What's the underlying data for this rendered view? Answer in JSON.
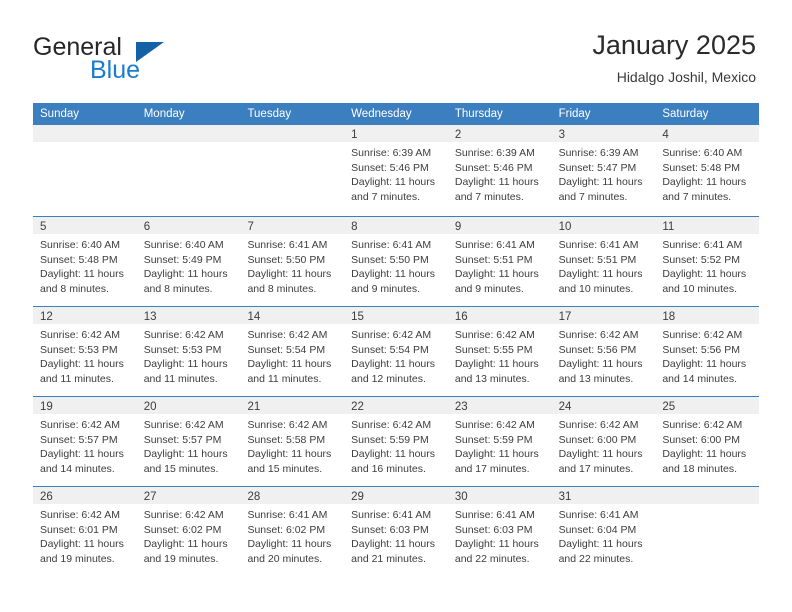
{
  "brand": {
    "name_line1": "General",
    "name_line2": "Blue",
    "accent_color": "#1b7ccd",
    "triangle_color": "#1362a8"
  },
  "header": {
    "title": "January 2025",
    "subtitle": "Hidalgo Joshil, Mexico"
  },
  "theme": {
    "weekday_bar_color": "#3c7fc1",
    "daynum_strip_color": "#f0f0f0",
    "text_color": "#3d3d3d"
  },
  "weekdays": [
    "Sunday",
    "Monday",
    "Tuesday",
    "Wednesday",
    "Thursday",
    "Friday",
    "Saturday"
  ],
  "labels": {
    "sunrise_prefix": "Sunrise:",
    "sunset_prefix": "Sunset:",
    "daylight_prefix": "Daylight:"
  },
  "weeks": [
    [
      {
        "day": "",
        "empty": true,
        "line1": "",
        "line2": "",
        "line3": "",
        "line4": ""
      },
      {
        "day": "",
        "empty": true,
        "line1": "",
        "line2": "",
        "line3": "",
        "line4": ""
      },
      {
        "day": "",
        "empty": true,
        "line1": "",
        "line2": "",
        "line3": "",
        "line4": ""
      },
      {
        "day": "1",
        "empty": false,
        "line1": "Sunrise: 6:39 AM",
        "line2": "Sunset: 5:46 PM",
        "line3": "Daylight: 11 hours",
        "line4": "and 7 minutes."
      },
      {
        "day": "2",
        "empty": false,
        "line1": "Sunrise: 6:39 AM",
        "line2": "Sunset: 5:46 PM",
        "line3": "Daylight: 11 hours",
        "line4": "and 7 minutes."
      },
      {
        "day": "3",
        "empty": false,
        "line1": "Sunrise: 6:39 AM",
        "line2": "Sunset: 5:47 PM",
        "line3": "Daylight: 11 hours",
        "line4": "and 7 minutes."
      },
      {
        "day": "4",
        "empty": false,
        "line1": "Sunrise: 6:40 AM",
        "line2": "Sunset: 5:48 PM",
        "line3": "Daylight: 11 hours",
        "line4": "and 7 minutes."
      }
    ],
    [
      {
        "day": "5",
        "empty": false,
        "line1": "Sunrise: 6:40 AM",
        "line2": "Sunset: 5:48 PM",
        "line3": "Daylight: 11 hours",
        "line4": "and 8 minutes."
      },
      {
        "day": "6",
        "empty": false,
        "line1": "Sunrise: 6:40 AM",
        "line2": "Sunset: 5:49 PM",
        "line3": "Daylight: 11 hours",
        "line4": "and 8 minutes."
      },
      {
        "day": "7",
        "empty": false,
        "line1": "Sunrise: 6:41 AM",
        "line2": "Sunset: 5:50 PM",
        "line3": "Daylight: 11 hours",
        "line4": "and 8 minutes."
      },
      {
        "day": "8",
        "empty": false,
        "line1": "Sunrise: 6:41 AM",
        "line2": "Sunset: 5:50 PM",
        "line3": "Daylight: 11 hours",
        "line4": "and 9 minutes."
      },
      {
        "day": "9",
        "empty": false,
        "line1": "Sunrise: 6:41 AM",
        "line2": "Sunset: 5:51 PM",
        "line3": "Daylight: 11 hours",
        "line4": "and 9 minutes."
      },
      {
        "day": "10",
        "empty": false,
        "line1": "Sunrise: 6:41 AM",
        "line2": "Sunset: 5:51 PM",
        "line3": "Daylight: 11 hours",
        "line4": "and 10 minutes."
      },
      {
        "day": "11",
        "empty": false,
        "line1": "Sunrise: 6:41 AM",
        "line2": "Sunset: 5:52 PM",
        "line3": "Daylight: 11 hours",
        "line4": "and 10 minutes."
      }
    ],
    [
      {
        "day": "12",
        "empty": false,
        "line1": "Sunrise: 6:42 AM",
        "line2": "Sunset: 5:53 PM",
        "line3": "Daylight: 11 hours",
        "line4": "and 11 minutes."
      },
      {
        "day": "13",
        "empty": false,
        "line1": "Sunrise: 6:42 AM",
        "line2": "Sunset: 5:53 PM",
        "line3": "Daylight: 11 hours",
        "line4": "and 11 minutes."
      },
      {
        "day": "14",
        "empty": false,
        "line1": "Sunrise: 6:42 AM",
        "line2": "Sunset: 5:54 PM",
        "line3": "Daylight: 11 hours",
        "line4": "and 11 minutes."
      },
      {
        "day": "15",
        "empty": false,
        "line1": "Sunrise: 6:42 AM",
        "line2": "Sunset: 5:54 PM",
        "line3": "Daylight: 11 hours",
        "line4": "and 12 minutes."
      },
      {
        "day": "16",
        "empty": false,
        "line1": "Sunrise: 6:42 AM",
        "line2": "Sunset: 5:55 PM",
        "line3": "Daylight: 11 hours",
        "line4": "and 13 minutes."
      },
      {
        "day": "17",
        "empty": false,
        "line1": "Sunrise: 6:42 AM",
        "line2": "Sunset: 5:56 PM",
        "line3": "Daylight: 11 hours",
        "line4": "and 13 minutes."
      },
      {
        "day": "18",
        "empty": false,
        "line1": "Sunrise: 6:42 AM",
        "line2": "Sunset: 5:56 PM",
        "line3": "Daylight: 11 hours",
        "line4": "and 14 minutes."
      }
    ],
    [
      {
        "day": "19",
        "empty": false,
        "line1": "Sunrise: 6:42 AM",
        "line2": "Sunset: 5:57 PM",
        "line3": "Daylight: 11 hours",
        "line4": "and 14 minutes."
      },
      {
        "day": "20",
        "empty": false,
        "line1": "Sunrise: 6:42 AM",
        "line2": "Sunset: 5:57 PM",
        "line3": "Daylight: 11 hours",
        "line4": "and 15 minutes."
      },
      {
        "day": "21",
        "empty": false,
        "line1": "Sunrise: 6:42 AM",
        "line2": "Sunset: 5:58 PM",
        "line3": "Daylight: 11 hours",
        "line4": "and 15 minutes."
      },
      {
        "day": "22",
        "empty": false,
        "line1": "Sunrise: 6:42 AM",
        "line2": "Sunset: 5:59 PM",
        "line3": "Daylight: 11 hours",
        "line4": "and 16 minutes."
      },
      {
        "day": "23",
        "empty": false,
        "line1": "Sunrise: 6:42 AM",
        "line2": "Sunset: 5:59 PM",
        "line3": "Daylight: 11 hours",
        "line4": "and 17 minutes."
      },
      {
        "day": "24",
        "empty": false,
        "line1": "Sunrise: 6:42 AM",
        "line2": "Sunset: 6:00 PM",
        "line3": "Daylight: 11 hours",
        "line4": "and 17 minutes."
      },
      {
        "day": "25",
        "empty": false,
        "line1": "Sunrise: 6:42 AM",
        "line2": "Sunset: 6:00 PM",
        "line3": "Daylight: 11 hours",
        "line4": "and 18 minutes."
      }
    ],
    [
      {
        "day": "26",
        "empty": false,
        "line1": "Sunrise: 6:42 AM",
        "line2": "Sunset: 6:01 PM",
        "line3": "Daylight: 11 hours",
        "line4": "and 19 minutes."
      },
      {
        "day": "27",
        "empty": false,
        "line1": "Sunrise: 6:42 AM",
        "line2": "Sunset: 6:02 PM",
        "line3": "Daylight: 11 hours",
        "line4": "and 19 minutes."
      },
      {
        "day": "28",
        "empty": false,
        "line1": "Sunrise: 6:41 AM",
        "line2": "Sunset: 6:02 PM",
        "line3": "Daylight: 11 hours",
        "line4": "and 20 minutes."
      },
      {
        "day": "29",
        "empty": false,
        "line1": "Sunrise: 6:41 AM",
        "line2": "Sunset: 6:03 PM",
        "line3": "Daylight: 11 hours",
        "line4": "and 21 minutes."
      },
      {
        "day": "30",
        "empty": false,
        "line1": "Sunrise: 6:41 AM",
        "line2": "Sunset: 6:03 PM",
        "line3": "Daylight: 11 hours",
        "line4": "and 22 minutes."
      },
      {
        "day": "31",
        "empty": false,
        "line1": "Sunrise: 6:41 AM",
        "line2": "Sunset: 6:04 PM",
        "line3": "Daylight: 11 hours",
        "line4": "and 22 minutes."
      },
      {
        "day": "",
        "empty": true,
        "line1": "",
        "line2": "",
        "line3": "",
        "line4": ""
      }
    ]
  ]
}
